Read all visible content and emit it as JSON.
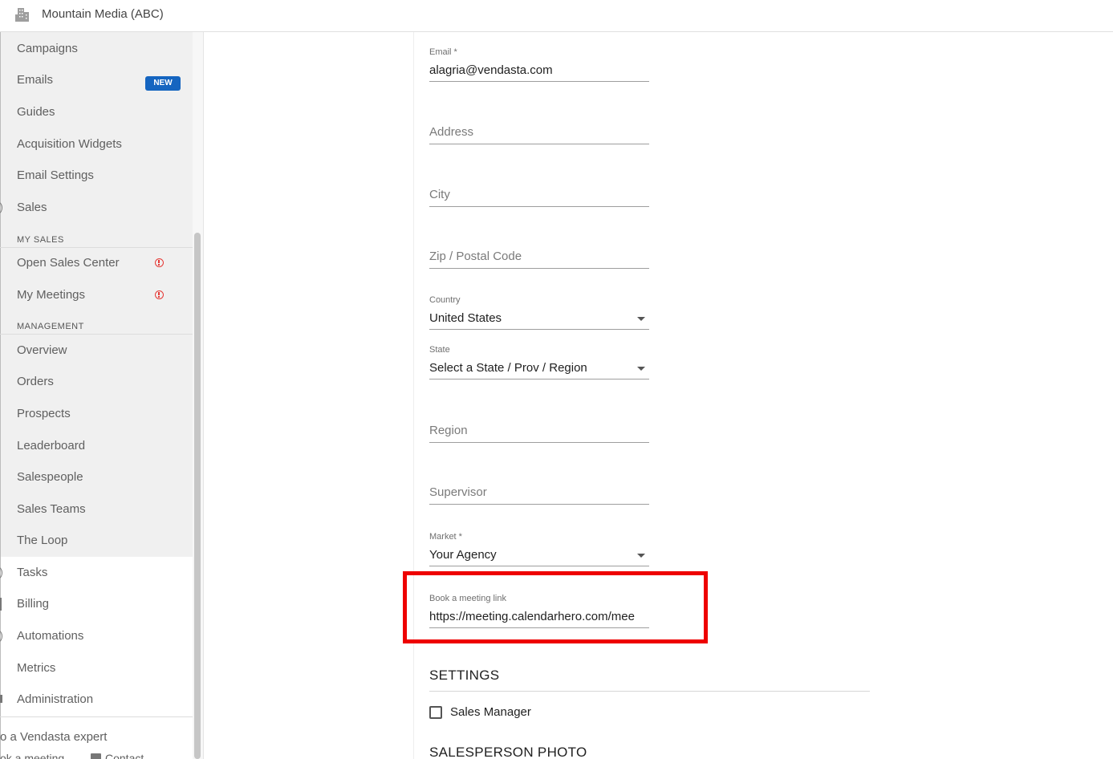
{
  "header": {
    "org_name": "Mountain Media (ABC)",
    "icon": "building-icon"
  },
  "sidebar": {
    "items": {
      "campaigns": "Campaigns",
      "emails": "Emails",
      "emails_badge": "NEW",
      "guides": "Guides",
      "acquisition_widgets": "Acquisition Widgets",
      "email_settings": "Email Settings",
      "sales": "Sales",
      "open_sales_center": "Open Sales Center",
      "my_meetings": "My Meetings",
      "overview": "Overview",
      "orders": "Orders",
      "prospects": "Prospects",
      "leaderboard": "Leaderboard",
      "salespeople": "Salespeople",
      "sales_teams": "Sales Teams",
      "the_loop": "The Loop",
      "tasks": "Tasks",
      "billing": "Billing",
      "automations": "Automations",
      "metrics": "Metrics",
      "administration": "Administration"
    },
    "sections": {
      "my_sales": "MY SALES",
      "management": "MANAGEMENT"
    },
    "footer": {
      "expert_text": "o a Vendasta expert",
      "meeting_text": "ok a meeting",
      "contact_text": "Contact"
    }
  },
  "form": {
    "email": {
      "label": "Email *",
      "value": "alagria@vendasta.com"
    },
    "address": {
      "placeholder": "Address"
    },
    "city": {
      "placeholder": "City"
    },
    "zip": {
      "placeholder": "Zip / Postal Code"
    },
    "country": {
      "label": "Country",
      "value": "United States"
    },
    "state": {
      "label": "State",
      "value": "Select a State / Prov / Region"
    },
    "region": {
      "placeholder": "Region"
    },
    "supervisor": {
      "placeholder": "Supervisor"
    },
    "market": {
      "label": "Market *",
      "value": "Your Agency"
    },
    "meeting_link": {
      "label": "Book a meeting link",
      "value": "https://meeting.calendarhero.com/mee"
    }
  },
  "settings": {
    "title": "SETTINGS",
    "sales_manager_label": "Sales Manager",
    "sales_manager_checked": false
  },
  "photo": {
    "title": "SALESPERSON PHOTO"
  },
  "colors": {
    "badge": "#1565c0",
    "alert": "#e53935",
    "highlight": "#ee0000"
  }
}
